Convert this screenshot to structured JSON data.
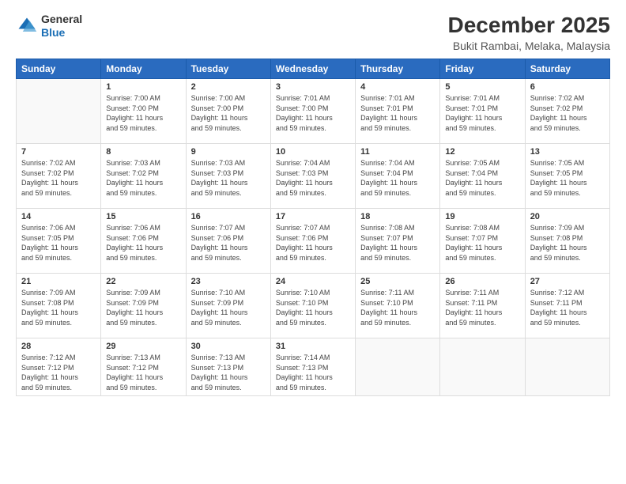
{
  "header": {
    "logo_line1": "General",
    "logo_line2": "Blue",
    "main_title": "December 2025",
    "subtitle": "Bukit Rambai, Melaka, Malaysia"
  },
  "weekdays": [
    "Sunday",
    "Monday",
    "Tuesday",
    "Wednesday",
    "Thursday",
    "Friday",
    "Saturday"
  ],
  "weeks": [
    [
      {
        "day": "",
        "info": ""
      },
      {
        "day": "1",
        "info": "Sunrise: 7:00 AM\nSunset: 7:00 PM\nDaylight: 11 hours\nand 59 minutes."
      },
      {
        "day": "2",
        "info": "Sunrise: 7:00 AM\nSunset: 7:00 PM\nDaylight: 11 hours\nand 59 minutes."
      },
      {
        "day": "3",
        "info": "Sunrise: 7:01 AM\nSunset: 7:00 PM\nDaylight: 11 hours\nand 59 minutes."
      },
      {
        "day": "4",
        "info": "Sunrise: 7:01 AM\nSunset: 7:01 PM\nDaylight: 11 hours\nand 59 minutes."
      },
      {
        "day": "5",
        "info": "Sunrise: 7:01 AM\nSunset: 7:01 PM\nDaylight: 11 hours\nand 59 minutes."
      },
      {
        "day": "6",
        "info": "Sunrise: 7:02 AM\nSunset: 7:02 PM\nDaylight: 11 hours\nand 59 minutes."
      }
    ],
    [
      {
        "day": "7",
        "info": "Sunrise: 7:02 AM\nSunset: 7:02 PM\nDaylight: 11 hours\nand 59 minutes."
      },
      {
        "day": "8",
        "info": "Sunrise: 7:03 AM\nSunset: 7:02 PM\nDaylight: 11 hours\nand 59 minutes."
      },
      {
        "day": "9",
        "info": "Sunrise: 7:03 AM\nSunset: 7:03 PM\nDaylight: 11 hours\nand 59 minutes."
      },
      {
        "day": "10",
        "info": "Sunrise: 7:04 AM\nSunset: 7:03 PM\nDaylight: 11 hours\nand 59 minutes."
      },
      {
        "day": "11",
        "info": "Sunrise: 7:04 AM\nSunset: 7:04 PM\nDaylight: 11 hours\nand 59 minutes."
      },
      {
        "day": "12",
        "info": "Sunrise: 7:05 AM\nSunset: 7:04 PM\nDaylight: 11 hours\nand 59 minutes."
      },
      {
        "day": "13",
        "info": "Sunrise: 7:05 AM\nSunset: 7:05 PM\nDaylight: 11 hours\nand 59 minutes."
      }
    ],
    [
      {
        "day": "14",
        "info": "Sunrise: 7:06 AM\nSunset: 7:05 PM\nDaylight: 11 hours\nand 59 minutes."
      },
      {
        "day": "15",
        "info": "Sunrise: 7:06 AM\nSunset: 7:06 PM\nDaylight: 11 hours\nand 59 minutes."
      },
      {
        "day": "16",
        "info": "Sunrise: 7:07 AM\nSunset: 7:06 PM\nDaylight: 11 hours\nand 59 minutes."
      },
      {
        "day": "17",
        "info": "Sunrise: 7:07 AM\nSunset: 7:06 PM\nDaylight: 11 hours\nand 59 minutes."
      },
      {
        "day": "18",
        "info": "Sunrise: 7:08 AM\nSunset: 7:07 PM\nDaylight: 11 hours\nand 59 minutes."
      },
      {
        "day": "19",
        "info": "Sunrise: 7:08 AM\nSunset: 7:07 PM\nDaylight: 11 hours\nand 59 minutes."
      },
      {
        "day": "20",
        "info": "Sunrise: 7:09 AM\nSunset: 7:08 PM\nDaylight: 11 hours\nand 59 minutes."
      }
    ],
    [
      {
        "day": "21",
        "info": "Sunrise: 7:09 AM\nSunset: 7:08 PM\nDaylight: 11 hours\nand 59 minutes."
      },
      {
        "day": "22",
        "info": "Sunrise: 7:09 AM\nSunset: 7:09 PM\nDaylight: 11 hours\nand 59 minutes."
      },
      {
        "day": "23",
        "info": "Sunrise: 7:10 AM\nSunset: 7:09 PM\nDaylight: 11 hours\nand 59 minutes."
      },
      {
        "day": "24",
        "info": "Sunrise: 7:10 AM\nSunset: 7:10 PM\nDaylight: 11 hours\nand 59 minutes."
      },
      {
        "day": "25",
        "info": "Sunrise: 7:11 AM\nSunset: 7:10 PM\nDaylight: 11 hours\nand 59 minutes."
      },
      {
        "day": "26",
        "info": "Sunrise: 7:11 AM\nSunset: 7:11 PM\nDaylight: 11 hours\nand 59 minutes."
      },
      {
        "day": "27",
        "info": "Sunrise: 7:12 AM\nSunset: 7:11 PM\nDaylight: 11 hours\nand 59 minutes."
      }
    ],
    [
      {
        "day": "28",
        "info": "Sunrise: 7:12 AM\nSunset: 7:12 PM\nDaylight: 11 hours\nand 59 minutes."
      },
      {
        "day": "29",
        "info": "Sunrise: 7:13 AM\nSunset: 7:12 PM\nDaylight: 11 hours\nand 59 minutes."
      },
      {
        "day": "30",
        "info": "Sunrise: 7:13 AM\nSunset: 7:13 PM\nDaylight: 11 hours\nand 59 minutes."
      },
      {
        "day": "31",
        "info": "Sunrise: 7:14 AM\nSunset: 7:13 PM\nDaylight: 11 hours\nand 59 minutes."
      },
      {
        "day": "",
        "info": ""
      },
      {
        "day": "",
        "info": ""
      },
      {
        "day": "",
        "info": ""
      }
    ]
  ]
}
